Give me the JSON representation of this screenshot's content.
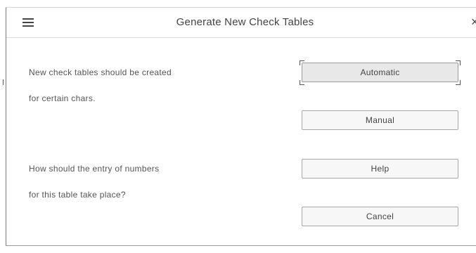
{
  "dialog": {
    "title": "Generate New Check Tables",
    "menu_icon": "hamburger-menu-icon",
    "close_glyph": "×"
  },
  "prompts": {
    "check_tables_line1": "New check tables should be created",
    "check_tables_line2": "for certain chars.",
    "numbers_line1": "How should the entry of numbers",
    "numbers_line2": "for this table take place?"
  },
  "buttons": {
    "automatic": "Automatic",
    "manual": "Manual",
    "help": "Help",
    "cancel": "Cancel"
  },
  "focused_button": "automatic"
}
